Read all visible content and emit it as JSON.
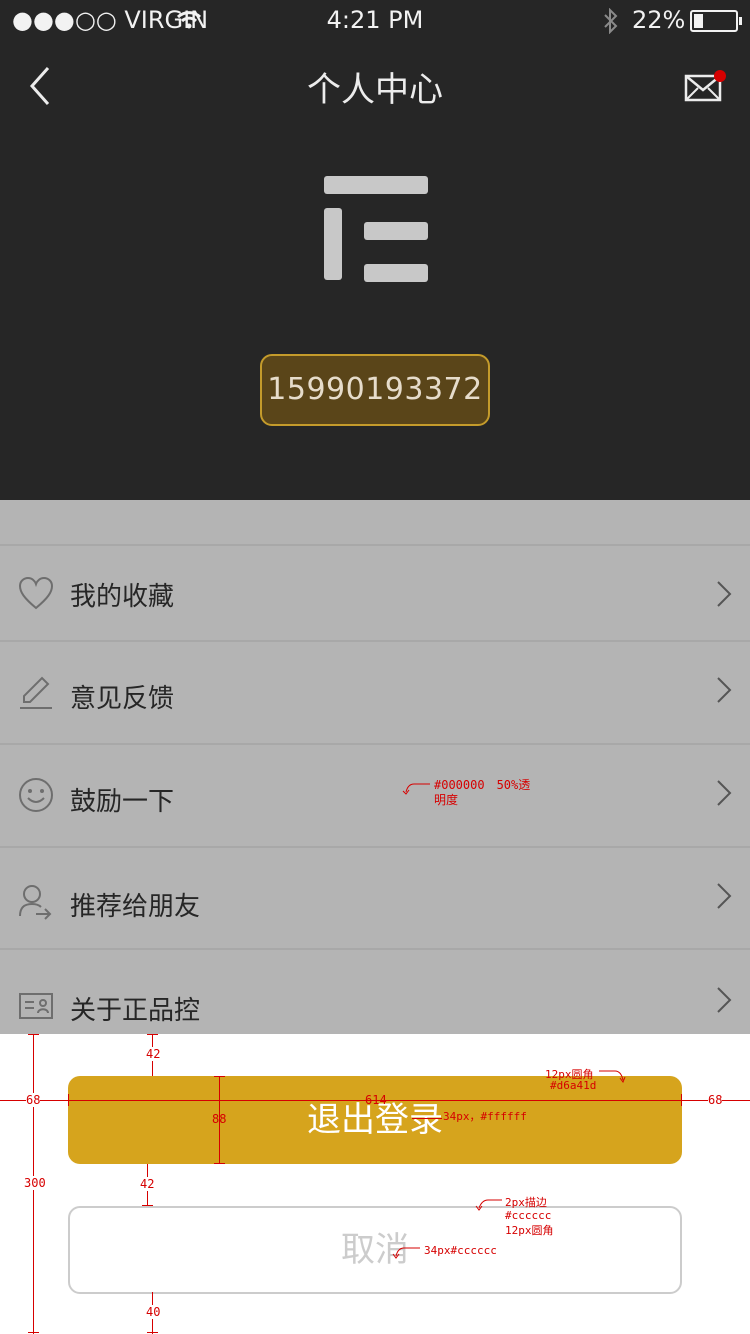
{
  "status_bar": {
    "carrier": "●●●○○ VIRGIN",
    "time": "4:21 PM",
    "battery": "22%"
  },
  "nav": {
    "title": "个人中心",
    "back_icon": "chevron-left-icon",
    "mail_icon": "mail-icon",
    "mail_badge_color": "#d60000"
  },
  "profile": {
    "phone": "15990193372",
    "logo_icon": "brand-logo-icon"
  },
  "menu": {
    "items": [
      {
        "label": "我的收藏",
        "icon": "heart-icon"
      },
      {
        "label": "意见反馈",
        "icon": "pencil-icon"
      },
      {
        "label": "鼓励一下",
        "icon": "smile-icon"
      },
      {
        "label": "推荐给朋友",
        "icon": "user-share-icon"
      },
      {
        "label": "关于正品控",
        "icon": "id-card-icon"
      }
    ]
  },
  "sheet": {
    "logout_label": "退出登录",
    "cancel_label": "取消",
    "logout_color": "#d6a41d",
    "cancel_border_color": "#cccccc"
  },
  "annotations": {
    "overlay_note_1": "#000000　50%透",
    "overlay_note_2": "明度",
    "radius_note_1": "12px圆角",
    "radius_note_2": "#d6a41d",
    "logout_font_note": "34px，#ffffff",
    "stroke_note_1": "2px描边",
    "stroke_note_2": "#cccccc",
    "stroke_note_3": "12px圆角",
    "cancel_font_note": "34px#cccccc",
    "dim_42_top": "42",
    "dim_68_left": "68",
    "dim_68_right": "68",
    "dim_614": "614",
    "dim_88": "88",
    "dim_42_mid": "42",
    "dim_300": "300",
    "dim_40": "40"
  }
}
